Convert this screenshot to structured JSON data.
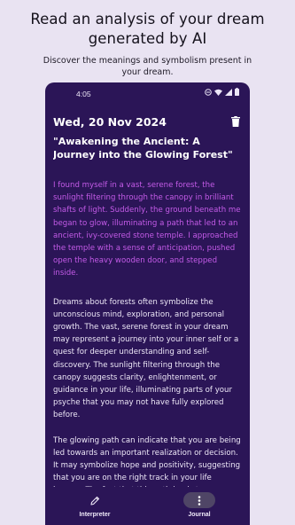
{
  "promo": {
    "title": "Read an analysis of your dream generated by AI",
    "subtitle": "Discover the meanings and symbolism present in your dream."
  },
  "statusbar": {
    "time": "4:05",
    "icons": [
      "dnd-icon",
      "wifi-icon",
      "signal-icon",
      "battery-icon"
    ]
  },
  "entry": {
    "date": "Wed, 20 Nov 2024",
    "title": "\"Awakening the Ancient: A Journey into the Glowing Forest\"",
    "dream_text": "I found myself in a vast, serene forest, the sunlight filtering through the canopy in brilliant shafts of light. Suddenly, the ground beneath me began to glow, illuminating a path that led to an ancient, ivy-covered stone temple. I approached the temple with a sense of anticipation, pushed open the heavy wooden door, and stepped inside.",
    "analysis": [
      "Dreams about forests often symbolize the unconscious mind, exploration, and personal growth. The vast, serene forest in your dream may represent a journey into your inner self or a quest for deeper understanding and self-discovery. The sunlight filtering through the canopy suggests clarity, enlightenment, or guidance in your life, illuminating parts of your psyche that you may not have fully explored before.",
      "The glowing path can indicate that you are being led towards an important realization or decision. It may symbolize hope and positivity, suggesting that you are on the right track in your life journey. The fact that this path leads to an ancient, ivy-covered stone temple can signify a search for spiritual wisdom, knowledge, or a connection to the past. Temples often represent places of"
    ]
  },
  "nav": {
    "interpreter_label": "Interpreter",
    "journal_label": "Journal",
    "active": "Journal"
  },
  "colors": {
    "page_background": "#e9e3f2",
    "phone_background": "#2b1557",
    "dream_text": "#c45be8",
    "active_indicator": "#4f4566"
  }
}
